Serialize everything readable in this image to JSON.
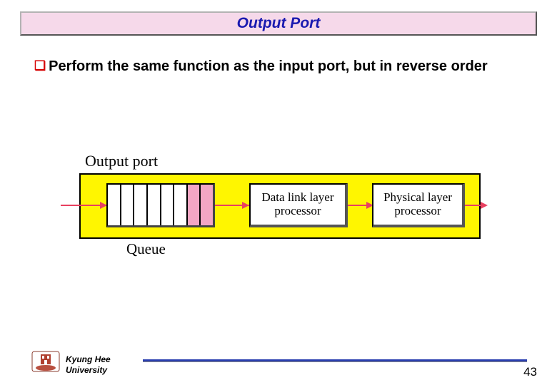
{
  "title": "Output Port",
  "bullet": {
    "marker": "❑",
    "text": "Perform the same function as the input port, but in reverse order"
  },
  "diagram": {
    "label": "Output port",
    "queue_label": "Queue",
    "box1": "Data link layer processor",
    "box2": "Physical layer processor"
  },
  "footer": {
    "university_line1": "Kyung Hee",
    "university_line2": "University"
  },
  "page_number": "43"
}
